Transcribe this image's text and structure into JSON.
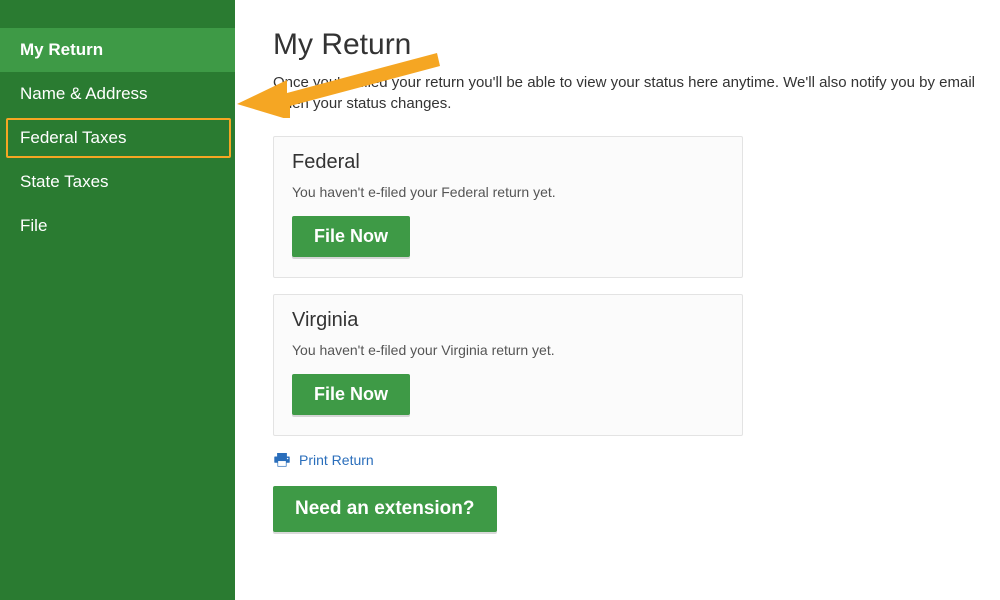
{
  "sidebar": {
    "items": [
      {
        "label": "My Return"
      },
      {
        "label": "Name & Address"
      },
      {
        "label": "Federal Taxes"
      },
      {
        "label": "State Taxes"
      },
      {
        "label": "File"
      }
    ]
  },
  "page": {
    "title": "My Return",
    "intro": "Once you've filed your return you'll be able to view your status here anytime. We'll also notify you by email when your status changes."
  },
  "federal": {
    "title": "Federal",
    "status": "You haven't e-filed your Federal return yet.",
    "button": "File Now"
  },
  "virginia": {
    "title": "Virginia",
    "status": "You haven't e-filed your Virginia return yet.",
    "button": "File Now"
  },
  "print": {
    "label": "Print Return"
  },
  "extension": {
    "button": "Need an extension?"
  }
}
